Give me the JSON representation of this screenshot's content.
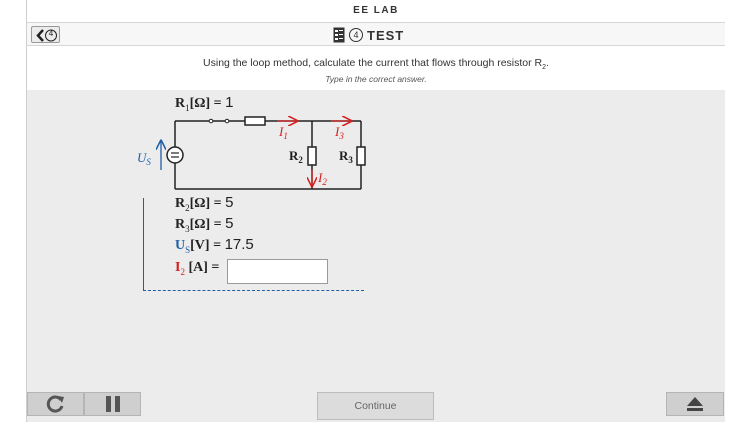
{
  "app": {
    "title": "EE LAB"
  },
  "nav": {
    "back_badge": "4",
    "section_number": "4",
    "section_label": "TEST"
  },
  "question": {
    "text_main": "Using the loop method, calculate the current that flows through resistor R",
    "text_sub": "2",
    "text_end": ".",
    "instruction": "Type in the correct answer."
  },
  "circuit": {
    "r1_label": "R",
    "r1_sub": "1",
    "r1_unit": "[Ω] = ",
    "r1_value": "1",
    "us_label": "U",
    "us_sub": "S",
    "r2_label": "R",
    "r2_sub": "2",
    "r3_label": "R",
    "r3_sub": "3",
    "i1_label": "I",
    "i1_sub": "1",
    "i2_label": "I",
    "i2_sub": "2",
    "i3_label": "I",
    "i3_sub": "3"
  },
  "given": {
    "r2": {
      "label": "R",
      "sub": "2",
      "unit": "[Ω] = ",
      "value": "5"
    },
    "r3": {
      "label": "R",
      "sub": "3",
      "unit": "[Ω] = ",
      "value": "5"
    },
    "us": {
      "label": "U",
      "sub": "S",
      "unit": "[V] = ",
      "value": "17.5"
    },
    "i2": {
      "label": "I",
      "sub": "2",
      "unit": " [A] = "
    }
  },
  "answer": {
    "value": "",
    "placeholder": ""
  },
  "footer": {
    "continue_label": "Continue"
  },
  "colors": {
    "accent_blue": "#1f5fa6",
    "current_red": "#d62020"
  }
}
